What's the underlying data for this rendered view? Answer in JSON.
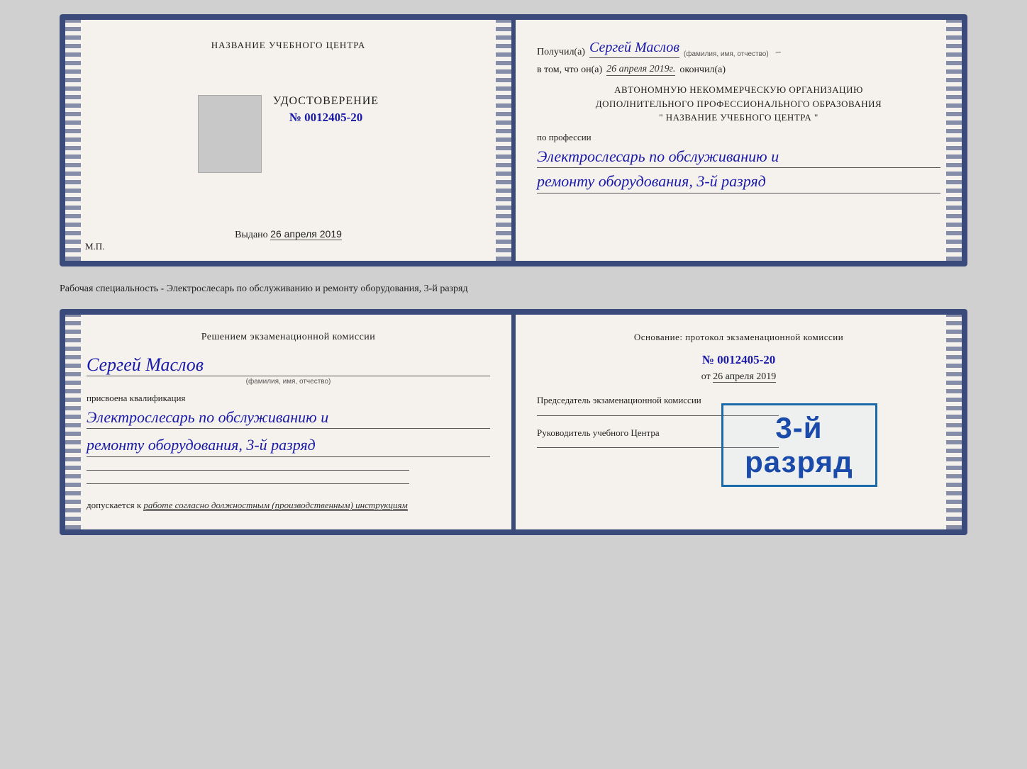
{
  "top_card": {
    "left": {
      "center_title": "НАЗВАНИЕ УЧЕБНОГО ЦЕНТРА",
      "udostoverenie_title": "УДОСТОВЕРЕНИЕ",
      "number_prefix": "№",
      "number": "0012405-20",
      "vydano_label": "Выдано",
      "vydano_date": "26 апреля 2019",
      "mp_label": "М.П."
    },
    "right": {
      "poluchil_label": "Получил(а)",
      "poluchil_name": "Сергей Маслов",
      "fio_label": "(фамилия, имя, отчество)",
      "dash": "–",
      "vtom_label": "в том, что он(а)",
      "vtom_date": "26 апреля 2019г.",
      "okoncil_label": "окончил(а)",
      "org_line1": "АВТОНОМНУЮ НЕКОММЕРЧЕСКУЮ ОРГАНИЗАЦИЮ",
      "org_line2": "ДОПОЛНИТЕЛЬНОГО ПРОФЕССИОНАЛЬНОГО ОБРАЗОВАНИЯ",
      "org_line3": "\"  НАЗВАНИЕ УЧЕБНОГО ЦЕНТРА  \"",
      "po_professii_label": "по профессии",
      "profession_line1": "Электрослесарь по обслуживанию и",
      "profession_line2": "ремонту оборудования, 3-й разряд"
    }
  },
  "middle_text": "Рабочая специальность - Электрослесарь по обслуживанию и ремонту оборудования, 3-й разряд",
  "bottom_card": {
    "left": {
      "resheniem_title": "Решением экзаменационной комиссии",
      "name": "Сергей Маслов",
      "fio_label": "(фамилия, имя, отчество)",
      "prisvoena_label": "присвоена квалификация",
      "qualification_line1": "Электрослесарь по обслуживанию и",
      "qualification_line2": "ремонту оборудования, 3-й разряд",
      "dopuskaetsya_label": "допускается к",
      "dopuskaetsya_text": "работе согласно должностным (производственным) инструкциям"
    },
    "right": {
      "osnovanie_label": "Основание: протокол экзаменационной комиссии",
      "number_prefix": "№",
      "number": "0012405-20",
      "ot_label": "от",
      "ot_date": "26 апреля 2019",
      "predsedatel_label": "Председатель экзаменационной комиссии",
      "rukovoditel_label": "Руководитель учебного Центра"
    },
    "stamp": {
      "line1": "3-й разряд"
    }
  }
}
